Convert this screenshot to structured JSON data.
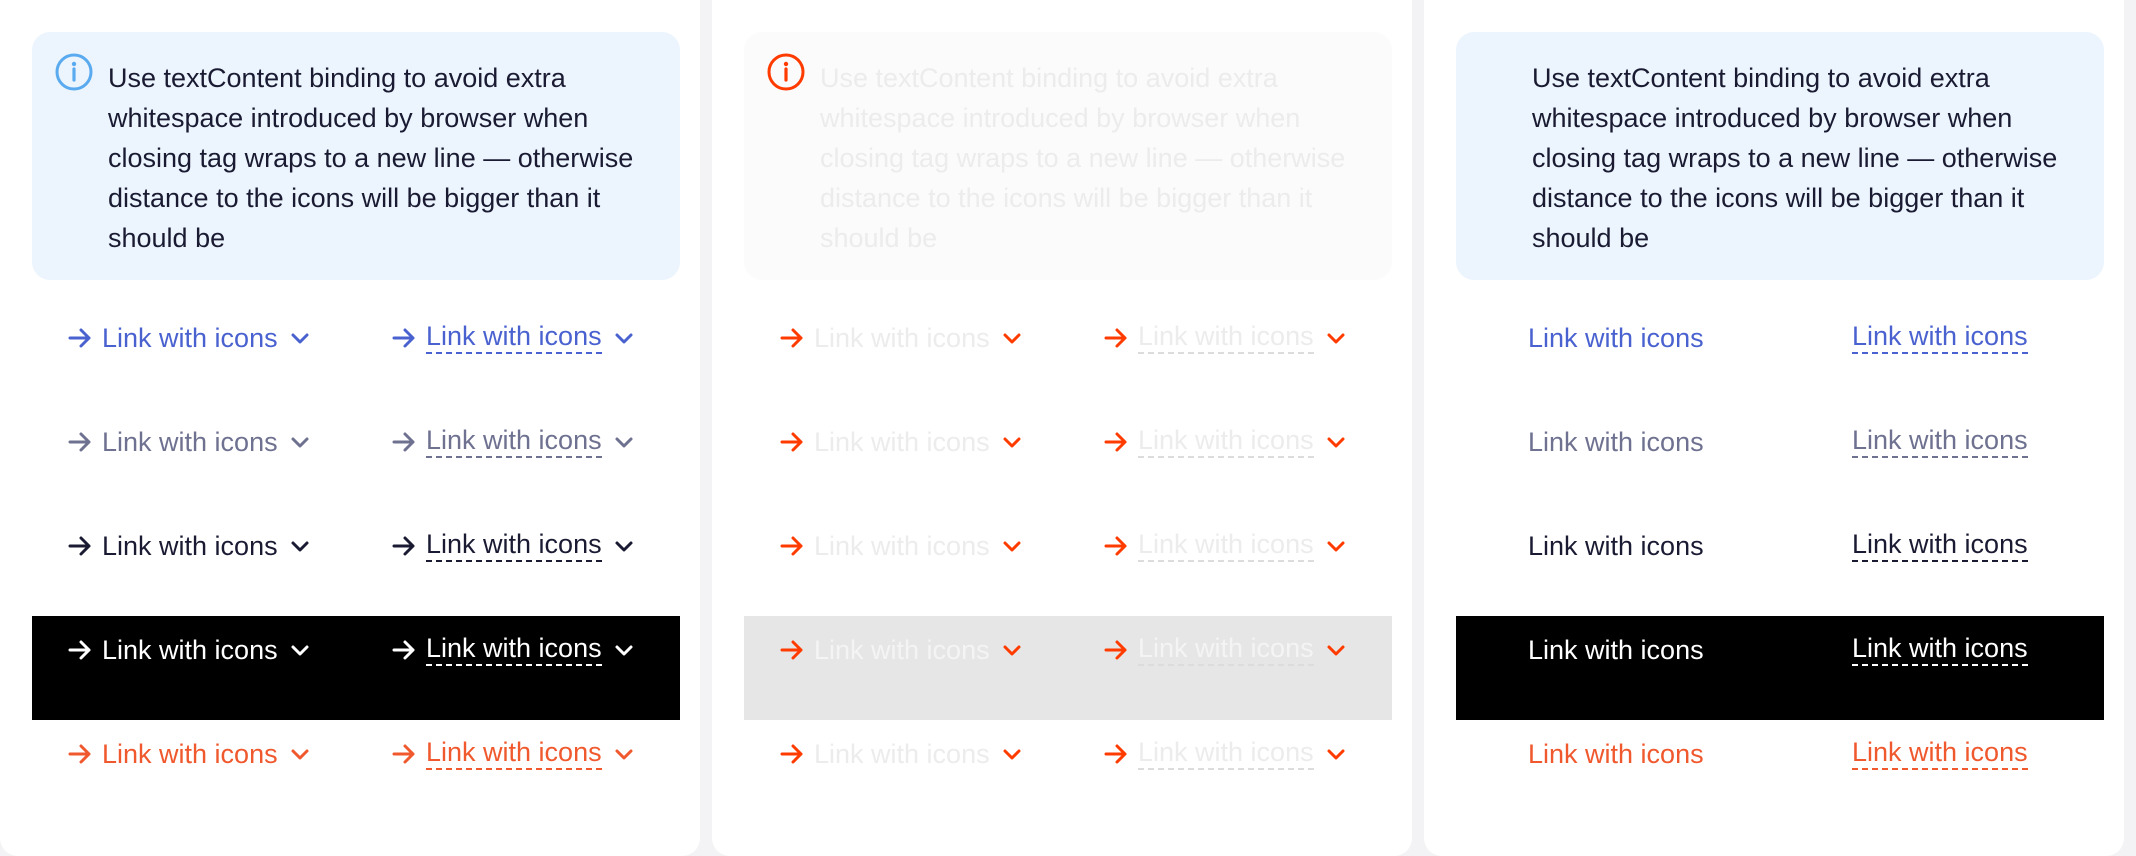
{
  "note_text": "Use textContent binding to avoid extra whitespace introduced by browser when closing tag wraps to a new line — otherwise distance to the icons will be bigger than it should be",
  "link_label": "Link with icons",
  "icons": {
    "info": "info-circle-icon",
    "arrow": "arrow-right-icon",
    "chevron": "chevron-down-icon"
  },
  "colors": {
    "blue": "#4a62d0",
    "grey": "#6e7190",
    "dark": "#1a1b33",
    "white": "#ffffff",
    "orange": "#f0582d",
    "red_icon": "#ff3b00",
    "info_blue": "#5aaaf0"
  },
  "panels": [
    {
      "id": "panel-with-icons",
      "note_style": "blue",
      "note_icon": "info-blue",
      "rows": [
        "blue",
        "grey",
        "dark",
        "white-on-black",
        "orange"
      ]
    },
    {
      "id": "panel-icons-only",
      "note_style": "faded",
      "note_icon": "info-red",
      "rows": [
        "faded",
        "faded",
        "faded",
        "faded-on-grey",
        "faded"
      ]
    },
    {
      "id": "panel-text-only",
      "note_style": "blue",
      "note_icon": "none",
      "rows": [
        "blue",
        "grey",
        "dark",
        "white-on-black",
        "orange"
      ]
    }
  ]
}
